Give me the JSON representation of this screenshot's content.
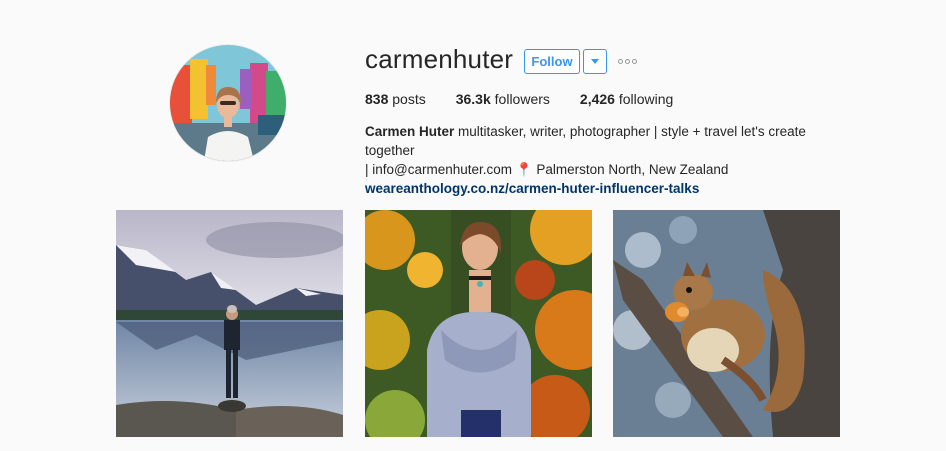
{
  "profile": {
    "username": "carmenhuter",
    "follow_label": "Follow",
    "stats": {
      "posts_count": "838",
      "posts_label": "posts",
      "followers_count": "36.3k",
      "followers_label": "followers",
      "following_count": "2,426",
      "following_label": "following"
    },
    "bio": {
      "full_name": "Carmen Huter",
      "line1": "multitasker, writer, photographer | style + travel let's create together",
      "line2": "| info@carmenhuter.com ",
      "pin": "📍",
      "location": "Palmerston North, New Zealand",
      "website": "weareanthology.co.nz/carmen-huter-influencer-talks"
    }
  },
  "posts": [
    {
      "icon": "mountain-lake-photo"
    },
    {
      "icon": "autumn-portrait-photo"
    },
    {
      "icon": "squirrel-photo"
    }
  ],
  "colors": {
    "accent": "#3897f0",
    "link": "#003569",
    "background": "#fafafa"
  }
}
